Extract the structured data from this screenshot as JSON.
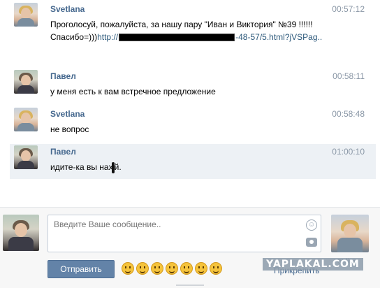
{
  "messages": [
    {
      "author": "Svetlana",
      "time": "00:57:12",
      "text_before": "Проголосуй, пожалуйста, за нашу пару \"Иван и Виктория\" №39 !!!!!! Спасибо=)))",
      "link_start": "http://",
      "link_end": "-48-57/5.html?jVSPag..",
      "avatar_icon": "user-photo-female"
    },
    {
      "author": "Павел",
      "time": "00:58:11",
      "text": "у меня есть к вам встречное предложение",
      "avatar_icon": "user-photo-male"
    },
    {
      "author": "Svetlana",
      "time": "00:58:48",
      "text": "не вопрос",
      "avatar_icon": "user-photo-female"
    },
    {
      "author": "Павел",
      "time": "01:00:10",
      "text_start": "идите-ка вы нах",
      "text_end": "й.",
      "avatar_icon": "user-photo-male",
      "highlighted": true
    }
  ],
  "composer": {
    "placeholder": "Введите Ваше сообщение..",
    "send_label": "Отправить",
    "attach_label": "Прикрепить",
    "peer_status": "online",
    "emoji_icons": [
      "smile-icon",
      "laugh-icon",
      "scared-icon",
      "kiss-icon",
      "neutral-icon",
      "blush-icon",
      "grin-icon"
    ]
  },
  "watermark": "YAPLAKAL.COM",
  "colors": {
    "author": "#45688e",
    "time": "#8a97a6",
    "link": "#2b587a",
    "highlight_bg": "#edf1f5",
    "button_bg": "#6383a8"
  }
}
